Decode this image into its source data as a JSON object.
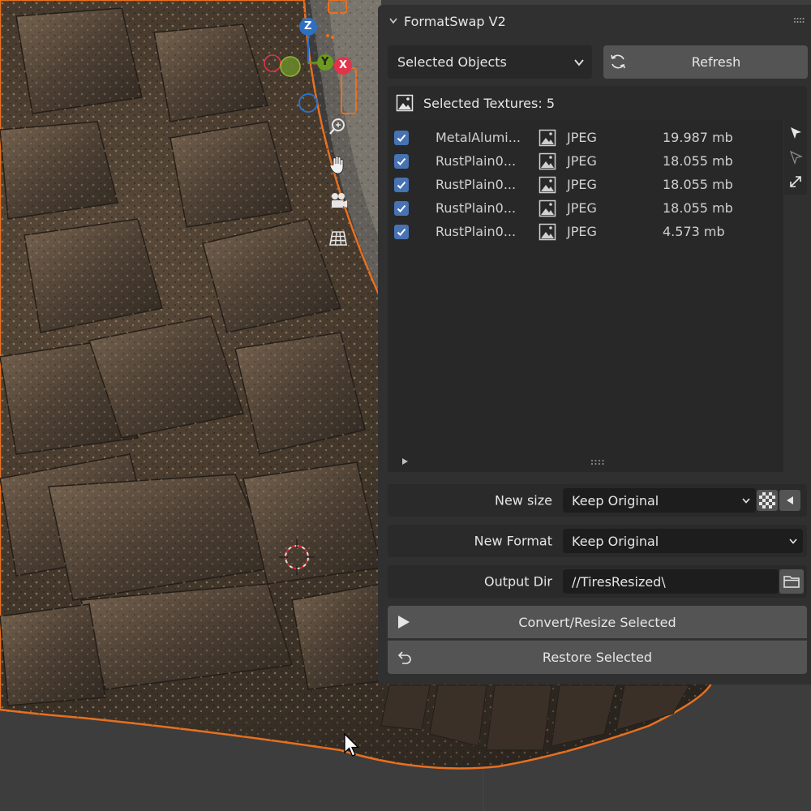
{
  "panel": {
    "title": "FormatSwap V2",
    "source_dropdown": {
      "selected": "Selected Objects"
    },
    "refresh_label": "Refresh",
    "textures_header": "Selected Textures: 5",
    "textures": [
      {
        "checked": true,
        "name": "MetalAlumi...",
        "icon": "image-icon",
        "format": "JPEG",
        "size": "19.987 mb"
      },
      {
        "checked": true,
        "name": "RustPlain0...",
        "icon": "image-icon",
        "format": "JPEG",
        "size": "18.055 mb"
      },
      {
        "checked": true,
        "name": "RustPlain0...",
        "icon": "image-icon",
        "format": "JPEG",
        "size": "18.055 mb"
      },
      {
        "checked": true,
        "name": "RustPlain0...",
        "icon": "image-icon",
        "format": "JPEG",
        "size": "18.055 mb"
      },
      {
        "checked": true,
        "name": "RustPlain0...",
        "icon": "image-icon",
        "format": "JPEG",
        "size": "4.573 mb"
      }
    ],
    "new_size": {
      "label": "New size",
      "value": "Keep Original"
    },
    "new_format": {
      "label": "New Format",
      "value": "Keep Original"
    },
    "output_dir": {
      "label": "Output Dir",
      "value": "//TiresResized\\"
    },
    "convert_label": "Convert/Resize Selected",
    "restore_label": "Restore Selected"
  },
  "gizmo": {
    "z": "Z",
    "y": "Y",
    "x": "X"
  },
  "colors": {
    "panel_bg": "#303030",
    "accent_checkbox": "#4772b3",
    "selection_outline": "#e8701f",
    "axis_x": "#e2334b",
    "axis_y": "#6b9a1f",
    "axis_z": "#2f6fc2"
  }
}
